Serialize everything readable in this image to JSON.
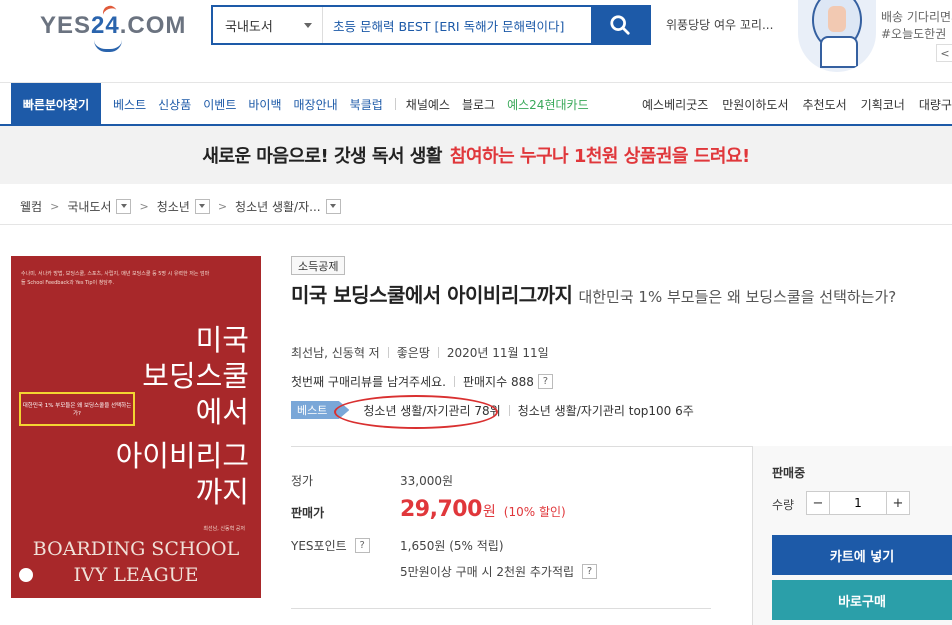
{
  "header": {
    "logo": "YES24.COM",
    "logo_prefix": "YES",
    "logo_num": "24",
    "logo_suffix": ".COM",
    "search_category": "국내도서",
    "search_value": "초등 문해력 BEST [ERI 독해가 문해력이다]",
    "hot_keyword": "위풍당당 여우 꼬리...",
    "banner_line1": "배송 기다리면서",
    "banner_line2": "#오늘도한권",
    "banner_ctrl": "<"
  },
  "nav": {
    "quick": "빠른분야찾기",
    "items": [
      "베스트",
      "신상품",
      "이벤트",
      "바이백",
      "매장안내",
      "북클럽"
    ],
    "items2": [
      "채널예스",
      "블로그"
    ],
    "card": "예스24현대카드",
    "right": [
      "예스베리굿즈",
      "만원이하도서",
      "추천도서",
      "기획코너",
      "대량구매"
    ]
  },
  "promo": {
    "text1": "새로운 마음으로! 갓생 독서 생활",
    "text2": "참여하는 누구나 1천원 상품권을 드려요!"
  },
  "breadcrumb": {
    "home": "웰컴",
    "c1": "국내도서",
    "c2": "청소년",
    "c3": "청소년 생활/자..."
  },
  "cover": {
    "small_text": "수나미, 서나카 방법, 보딩스쿨, 스포츠, 사립지, 매년 보딩스쿨 등 5명 시 유력한 저는 엄마들 School Feedback과 Yes Tip이 청담주.",
    "yellow_box": "대한민국 1% 부모들은 왜 보딩스쿨을 선택하는가?",
    "title_l1": "미국",
    "title_l2": "보딩스쿨",
    "title_l3": "에서",
    "title_l4": "아이비리그",
    "title_l5": "까지",
    "author": "최선남, 신동혁 공저",
    "en1": "BOARDING SCHOOL",
    "en2": "IVY LEAGUE"
  },
  "product": {
    "tag": "소득공제",
    "title": "미국 보딩스쿨에서 아이비리그까지",
    "subtitle": "대한민국 1% 부모들은 왜 보딩스쿨을 선택하는가?",
    "author": "최선남, 신동혁 저",
    "publisher": "좋은땅",
    "date": "2020년 11월 11일",
    "review": "첫번째 구매리뷰를 남겨주세요.",
    "sales_index": "판매지수 888",
    "help": "?",
    "best_badge": "베스트",
    "rank1": "청소년 생활/자기관리 78위",
    "rank2": "청소년 생활/자기관리 top100 6주"
  },
  "price": {
    "list_label": "정가",
    "list_value": "33,000원",
    "sale_label": "판매가",
    "sale_value": "29,700",
    "sale_unit": "원",
    "sale_pct": "(10% 할인)",
    "point_label": "YES포인트",
    "point_value": "1,650원 (5% 적립)",
    "extra_point": "5만원이상 구매 시 2천원 추가적립"
  },
  "buy": {
    "status": "판매중",
    "qty_label": "수량",
    "qty_minus": "−",
    "qty_value": "1",
    "qty_plus": "+",
    "cart": "카트에 넣기",
    "buy_now": "바로구매"
  }
}
